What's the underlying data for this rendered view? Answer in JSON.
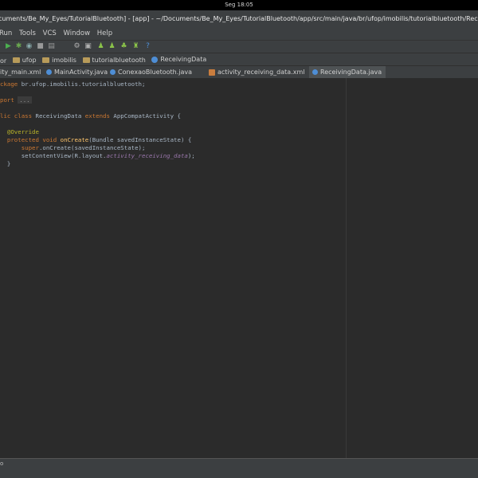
{
  "os_bar": {
    "clock": "Seg 18:05"
  },
  "window": {
    "title": "cuments/Be_My_Eyes/TutorialBluetooth] - [app] - ~/Documents/Be_My_Eyes/TutorialBluetooth/app/src/main/java/br/ufop/imobilis/tutorialbluetooth/ReceivingData"
  },
  "menu": {
    "items": [
      "Run",
      "Tools",
      "VCS",
      "Window",
      "Help"
    ]
  },
  "toolbar": {
    "icons": [
      "run-icon",
      "debug-icon",
      "attach-icon",
      "stop-icon",
      "sync-icon",
      "avd-icon",
      "sdk-icon",
      "android-icon",
      "help-icon"
    ]
  },
  "breadcrumbs": [
    {
      "label": "or",
      "icon": ""
    },
    {
      "label": "ufop",
      "icon": "folder"
    },
    {
      "label": "imobilis",
      "icon": "folder"
    },
    {
      "label": "tutorialbluetooth",
      "icon": "folder"
    },
    {
      "label": "ReceivingData",
      "icon": "class"
    }
  ],
  "tabs": [
    {
      "label": "ity_main.xml",
      "type": "xml",
      "active": false
    },
    {
      "label": "MainActivity.java",
      "type": "java",
      "active": false
    },
    {
      "label": "ConexaoBluetooth.java",
      "type": "java",
      "active": false
    },
    {
      "label": "activity_receiving_data.xml",
      "type": "xml",
      "active": false
    },
    {
      "label": "ReceivingData.java",
      "type": "java",
      "active": true
    }
  ],
  "code": {
    "l1a": "ckage ",
    "l1b": "br.ufop.imobilis.tutorialbluetooth;",
    "l3a": "port ",
    "l3b": "...",
    "l5a": "lic class ",
    "l5b": "ReceivingData ",
    "l5c": "extends ",
    "l5d": "AppCompatActivity {",
    "l7": "@Override",
    "l8a": "protected void ",
    "l8b": "onCreate",
    "l8c": "(Bundle savedInstanceState) {",
    "l9a": "super",
    "l9b": ".onCreate(savedInstanceState);",
    "l10a": "setContentView(R.layout.",
    "l10b": "activity_receiving_data",
    "l10c": ");",
    "l11": "}"
  },
  "status": {
    "text": "o"
  },
  "colors": {
    "keyword": "#cc7832",
    "annotation": "#bbb529",
    "method": "#ffc66d",
    "field": "#9876aa",
    "text": "#a9b7c6",
    "background": "#2b2b2b"
  }
}
